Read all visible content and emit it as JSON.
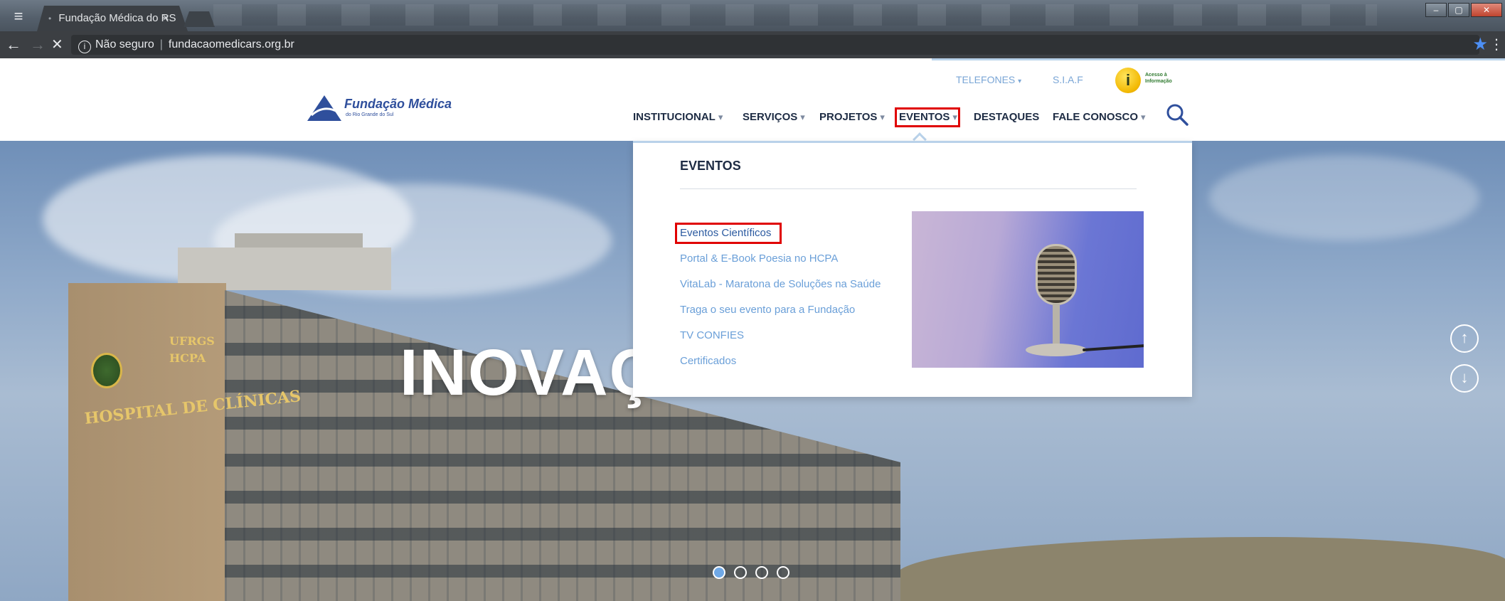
{
  "browser": {
    "tab_title": "Fundação Médica do RS",
    "tab_close": "×",
    "url_prefix": "Não seguro",
    "url": "fundacaomedicars.org.br"
  },
  "site": {
    "logo_name": "Fundação Médica",
    "logo_sub": "do Rio Grande do Sul",
    "util_nav": [
      "TELEFONES",
      "S.I.A.F"
    ],
    "acesso_info_line1": "Acesso à",
    "acesso_info_line2": "Informação",
    "main_nav": [
      {
        "label": "INSTITUCIONAL",
        "caret": true
      },
      {
        "label": "SERVIÇOS",
        "caret": true
      },
      {
        "label": "PROJETOS",
        "caret": true
      },
      {
        "label": "EVENTOS",
        "caret": true
      },
      {
        "label": "DESTAQUES",
        "caret": false
      },
      {
        "label": "FALE CONOSCO",
        "caret": true
      }
    ]
  },
  "dropdown": {
    "title": "EVENTOS",
    "links": [
      "Eventos Científicos",
      "Portal & E-Book Poesia no HCPA",
      "VitaLab - Maratona de Soluções na Saúde",
      "Traga o seu evento para a Fundação",
      "TV CONFIES",
      "Certificados"
    ]
  },
  "hero": {
    "title": "INOVAÇ",
    "building_sign": "HOSPITAL DE CLÍNICAS",
    "building_sign_small": [
      "UFRGS",
      "HCPA"
    ],
    "slides": 4,
    "active_slide": 0
  },
  "colors": {
    "highlight": "#e00000",
    "nav_text": "#1e2c44",
    "link": "#6a9fd8",
    "accent_line": "#b9d2ea"
  }
}
